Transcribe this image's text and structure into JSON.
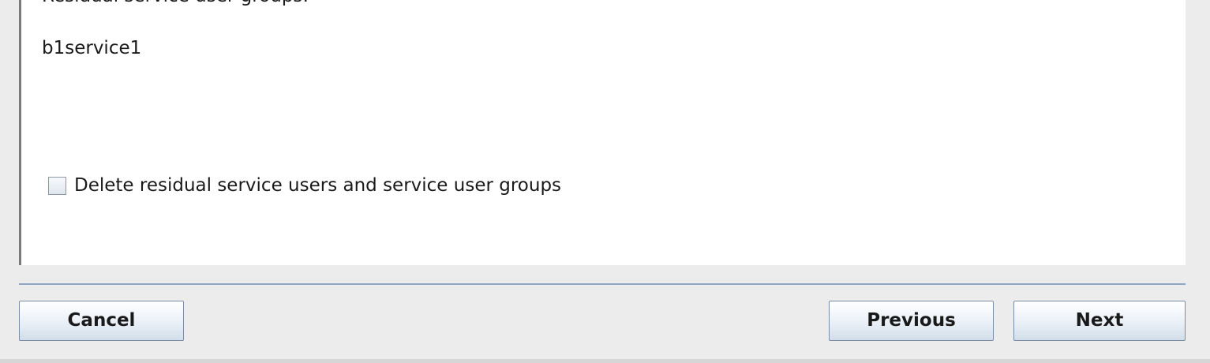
{
  "panel": {
    "heading": "Residual service user groups:",
    "groups": [
      "b1service1"
    ],
    "checkbox": {
      "label": "Delete residual service users and service user groups",
      "checked": false
    }
  },
  "buttons": {
    "cancel": "Cancel",
    "previous": "Previous",
    "next": "Next"
  }
}
